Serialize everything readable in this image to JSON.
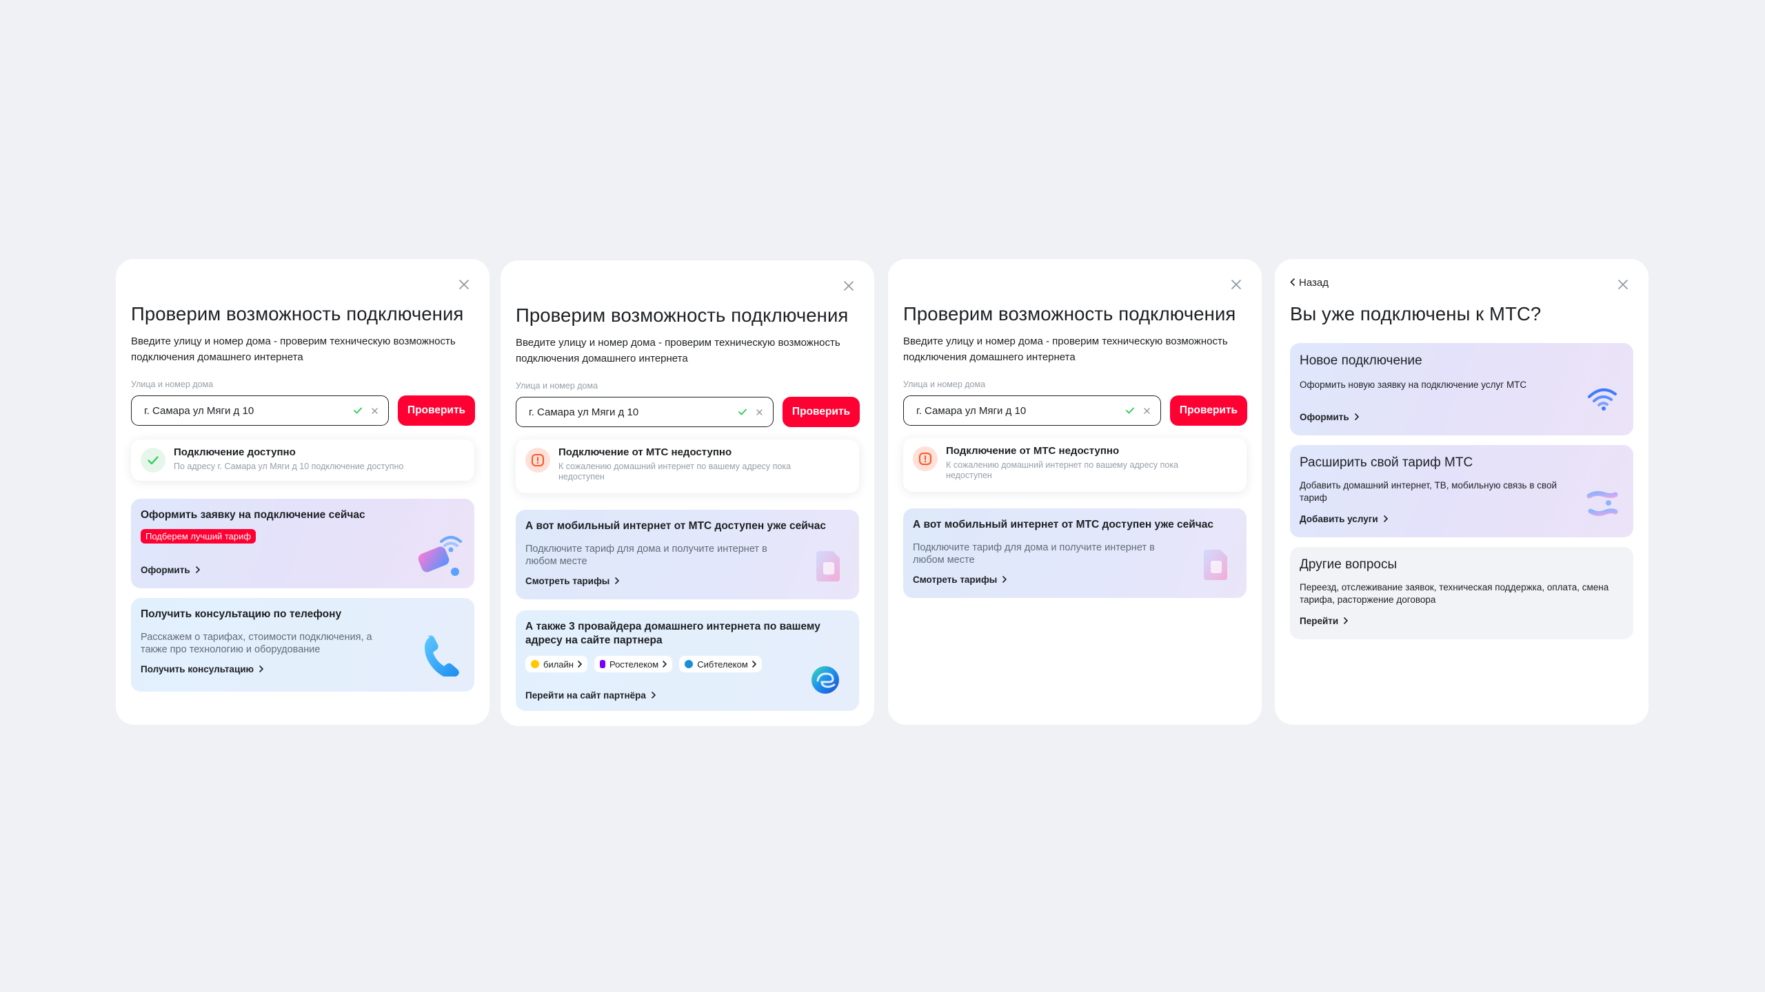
{
  "panels": [
    {
      "title": "Проверим возможность подключения",
      "description": "Введите улицу и номер дома - проверим техническую возможность подключения домашнего интернета",
      "field_label": "Улица и номер дома",
      "field_value": "г. Самара ул Мяги д 10",
      "check_button": "Проверить",
      "status": {
        "title": "Подключение доступно",
        "subtitle": "По адресу г. Самара ул Мяги д 10 подключение доступно"
      },
      "cards": [
        {
          "title": "Оформить заявку на подключение сейчас",
          "badge": "Подберем лучший тариф",
          "link": "Оформить"
        },
        {
          "title": "Получить консультацию по телефону",
          "description": "Расскажем о тарифах, стоимости подключения, а также про технологию и оборудование",
          "link": "Получить консультацию"
        }
      ]
    },
    {
      "title": "Проверим возможность подключения",
      "description": "Введите улицу и номер дома - проверим техническую возможность подключения домашнего интернета",
      "field_label": "Улица и номер дома",
      "field_value": "г. Самара ул Мяги д 10",
      "check_button": "Проверить",
      "status": {
        "title": "Подключение от МТС недоступно",
        "subtitle": "К сожалению домашний интернет по вашему адресу пока недоступен"
      },
      "cards": [
        {
          "title": "А вот мобильный интернет от МТС доступен уже сейчас",
          "description": "Подключите тариф для дома и получите интернет в любом месте",
          "link": "Смотреть тарифы"
        },
        {
          "title": "А также 3 провайдера домашнего интернета по вашему адресу на сайте партнера",
          "chips": [
            "билайн",
            "Ростелеком",
            "Сибтелеком"
          ],
          "link": "Перейти на сайт партнёра"
        }
      ]
    },
    {
      "title": "Проверим возможность подключения",
      "description": "Введите улицу и номер дома - проверим техническую возможность подключения домашнего интернета",
      "field_label": "Улица и номер дома",
      "field_value": "г. Самара ул Мяги д 10",
      "check_button": "Проверить",
      "status": {
        "title": "Подключение от МТС недоступно",
        "subtitle": "К сожалению домашний интернет по вашему адресу пока недоступен"
      },
      "cards": [
        {
          "title": "А вот мобильный интернет от МТС доступен уже сейчас",
          "description": "Подключите тариф для дома и получите интернет в любом месте",
          "link": "Смотреть тарифы"
        }
      ]
    },
    {
      "back": "Назад",
      "title": "Вы уже подключены к МТС?",
      "cards": [
        {
          "title": "Новое подключение",
          "description": "Оформить новую заявку на подключение услуг МТС",
          "link": "Оформить"
        },
        {
          "title": "Расширить свой тариф МТС",
          "description": "Добавить домашний интернет, ТВ, мобильную связь в свой тариф",
          "link": "Добавить услуги"
        },
        {
          "title": "Другие вопросы",
          "description": "Переезд, отслеживание заявок, техническая поддержка, оплата, смена тарифа, расторжение договора",
          "link": "Перейти"
        }
      ]
    }
  ],
  "colors": {
    "accent": "#ff0032",
    "success": "#26cd58",
    "background": "#eff1f5"
  },
  "icons": [
    "close-icon",
    "check-icon",
    "clear-icon",
    "warning-icon",
    "chevron-right-icon",
    "chevron-left-icon",
    "wifi-router-illustration",
    "phone-illustration",
    "sim-card-illustration",
    "edge-logo-illustration",
    "wifi-illustration",
    "hands-illustration"
  ]
}
